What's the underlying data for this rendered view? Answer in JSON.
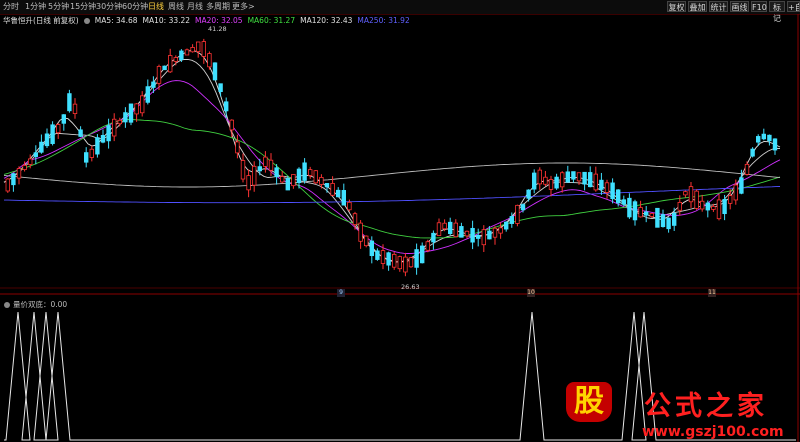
{
  "toolbar": {
    "tabs": [
      "分时",
      "1分钟",
      "5分钟",
      "15分钟",
      "30分钟",
      "60分钟",
      "日线",
      "周线",
      "月线",
      "多周期",
      "更多>"
    ],
    "active_tab": "日线",
    "right_buttons": [
      "复权",
      "叠加",
      "统计",
      "画线",
      "F10",
      "标记",
      "+自选"
    ]
  },
  "stock": {
    "title": "华鲁恒升(日线 前复权)",
    "ma": [
      {
        "label": "MA5: 34.68",
        "color": "#e0e0e0"
      },
      {
        "label": "MA10: 33.22",
        "color": "#e0e0e0"
      },
      {
        "label": "MA20: 32.05",
        "color": "#e040ff"
      },
      {
        "label": "MA60: 31.27",
        "color": "#40e040"
      },
      {
        "label": "MA120: 32.43",
        "color": "#e0e0e0"
      },
      {
        "label": "MA250: 31.92",
        "color": "#6060ff"
      }
    ]
  },
  "annotations": {
    "high": "41.28",
    "low": "26.63"
  },
  "date_markers": [
    "9",
    "10",
    "11"
  ],
  "indicator": {
    "title": "量价双底：0.00"
  },
  "watermark": {
    "logo": "股",
    "text": "公式之家",
    "url": "www.gszj100.com"
  },
  "colors": {
    "up": "#ff3333",
    "down": "#40e0ff",
    "ma5": "#e0e0e0",
    "ma20": "#d030ff",
    "ma60": "#40d040",
    "ma250": "#5050ff"
  }
}
